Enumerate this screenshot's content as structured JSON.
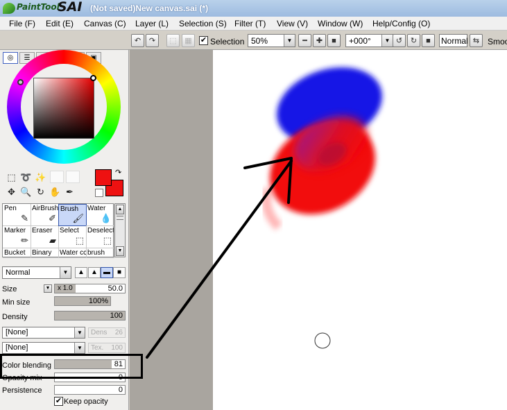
{
  "app": {
    "logo_brand": "PaintTool",
    "logo_name": "SAI",
    "window_title": "(Not saved)New canvas.sai (*)"
  },
  "menu": [
    {
      "label": "File (F)"
    },
    {
      "label": "Edit (E)"
    },
    {
      "label": "Canvas (C)"
    },
    {
      "label": "Layer (L)"
    },
    {
      "label": "Selection (S)"
    },
    {
      "label": "Filter (T)"
    },
    {
      "label": "View (V)"
    },
    {
      "label": "Window (W)"
    },
    {
      "label": "Help/Config (O)"
    }
  ],
  "toolbar": {
    "selection_label": "Selection",
    "selection_checked": "✔",
    "zoom_value": "50%",
    "rotation_value": "+000°",
    "blend_mode": "Normal",
    "stabilizer_label": "Smoo"
  },
  "color": {
    "primary": "#ee1111",
    "secondary": "#ee1111",
    "swap_glyph": "↷"
  },
  "brush_tools": [
    {
      "label": "Pen",
      "icon": "✎"
    },
    {
      "label": "AirBrush",
      "icon": "✐"
    },
    {
      "label": "Brush",
      "icon": "🖌"
    },
    {
      "label": "Water",
      "icon": "💧"
    },
    {
      "label": "Marker",
      "icon": "✏"
    },
    {
      "label": "Eraser",
      "icon": "▰"
    },
    {
      "label": "Select",
      "icon": "⬚"
    },
    {
      "label": "Deselect",
      "icon": "⬚"
    },
    {
      "label": "Bucket",
      "icon": ""
    },
    {
      "label": "Binary",
      "icon": ""
    },
    {
      "label": "Water cc",
      "icon": ""
    },
    {
      "label": "brush",
      "icon": ""
    }
  ],
  "brush_settings": {
    "blend_mode": "Normal",
    "size_label": "Size",
    "size_multiplier": "x 1.0",
    "size_value": "50.0",
    "min_size_label": "Min size",
    "min_size_value": "100%",
    "density_label": "Density",
    "density_value": "100",
    "texture1": "[None]",
    "texture1_param_label": "Dens",
    "texture1_param_value": "26",
    "texture2": "[None]",
    "texture2_param_label": "Tex.",
    "texture2_param_value": "100",
    "color_blending_label": "Color blending",
    "color_blending_value": "81",
    "opacity_mix_label": "Opacity mix",
    "opacity_mix_value": "0",
    "persistence_label": "Persistence",
    "persistence_value": "0",
    "keep_opacity_label": "Keep opacity",
    "keep_opacity_checked": "✔"
  },
  "progress": {
    "color_blending": 0.81,
    "min_size": 1.0,
    "density": 1.0
  }
}
